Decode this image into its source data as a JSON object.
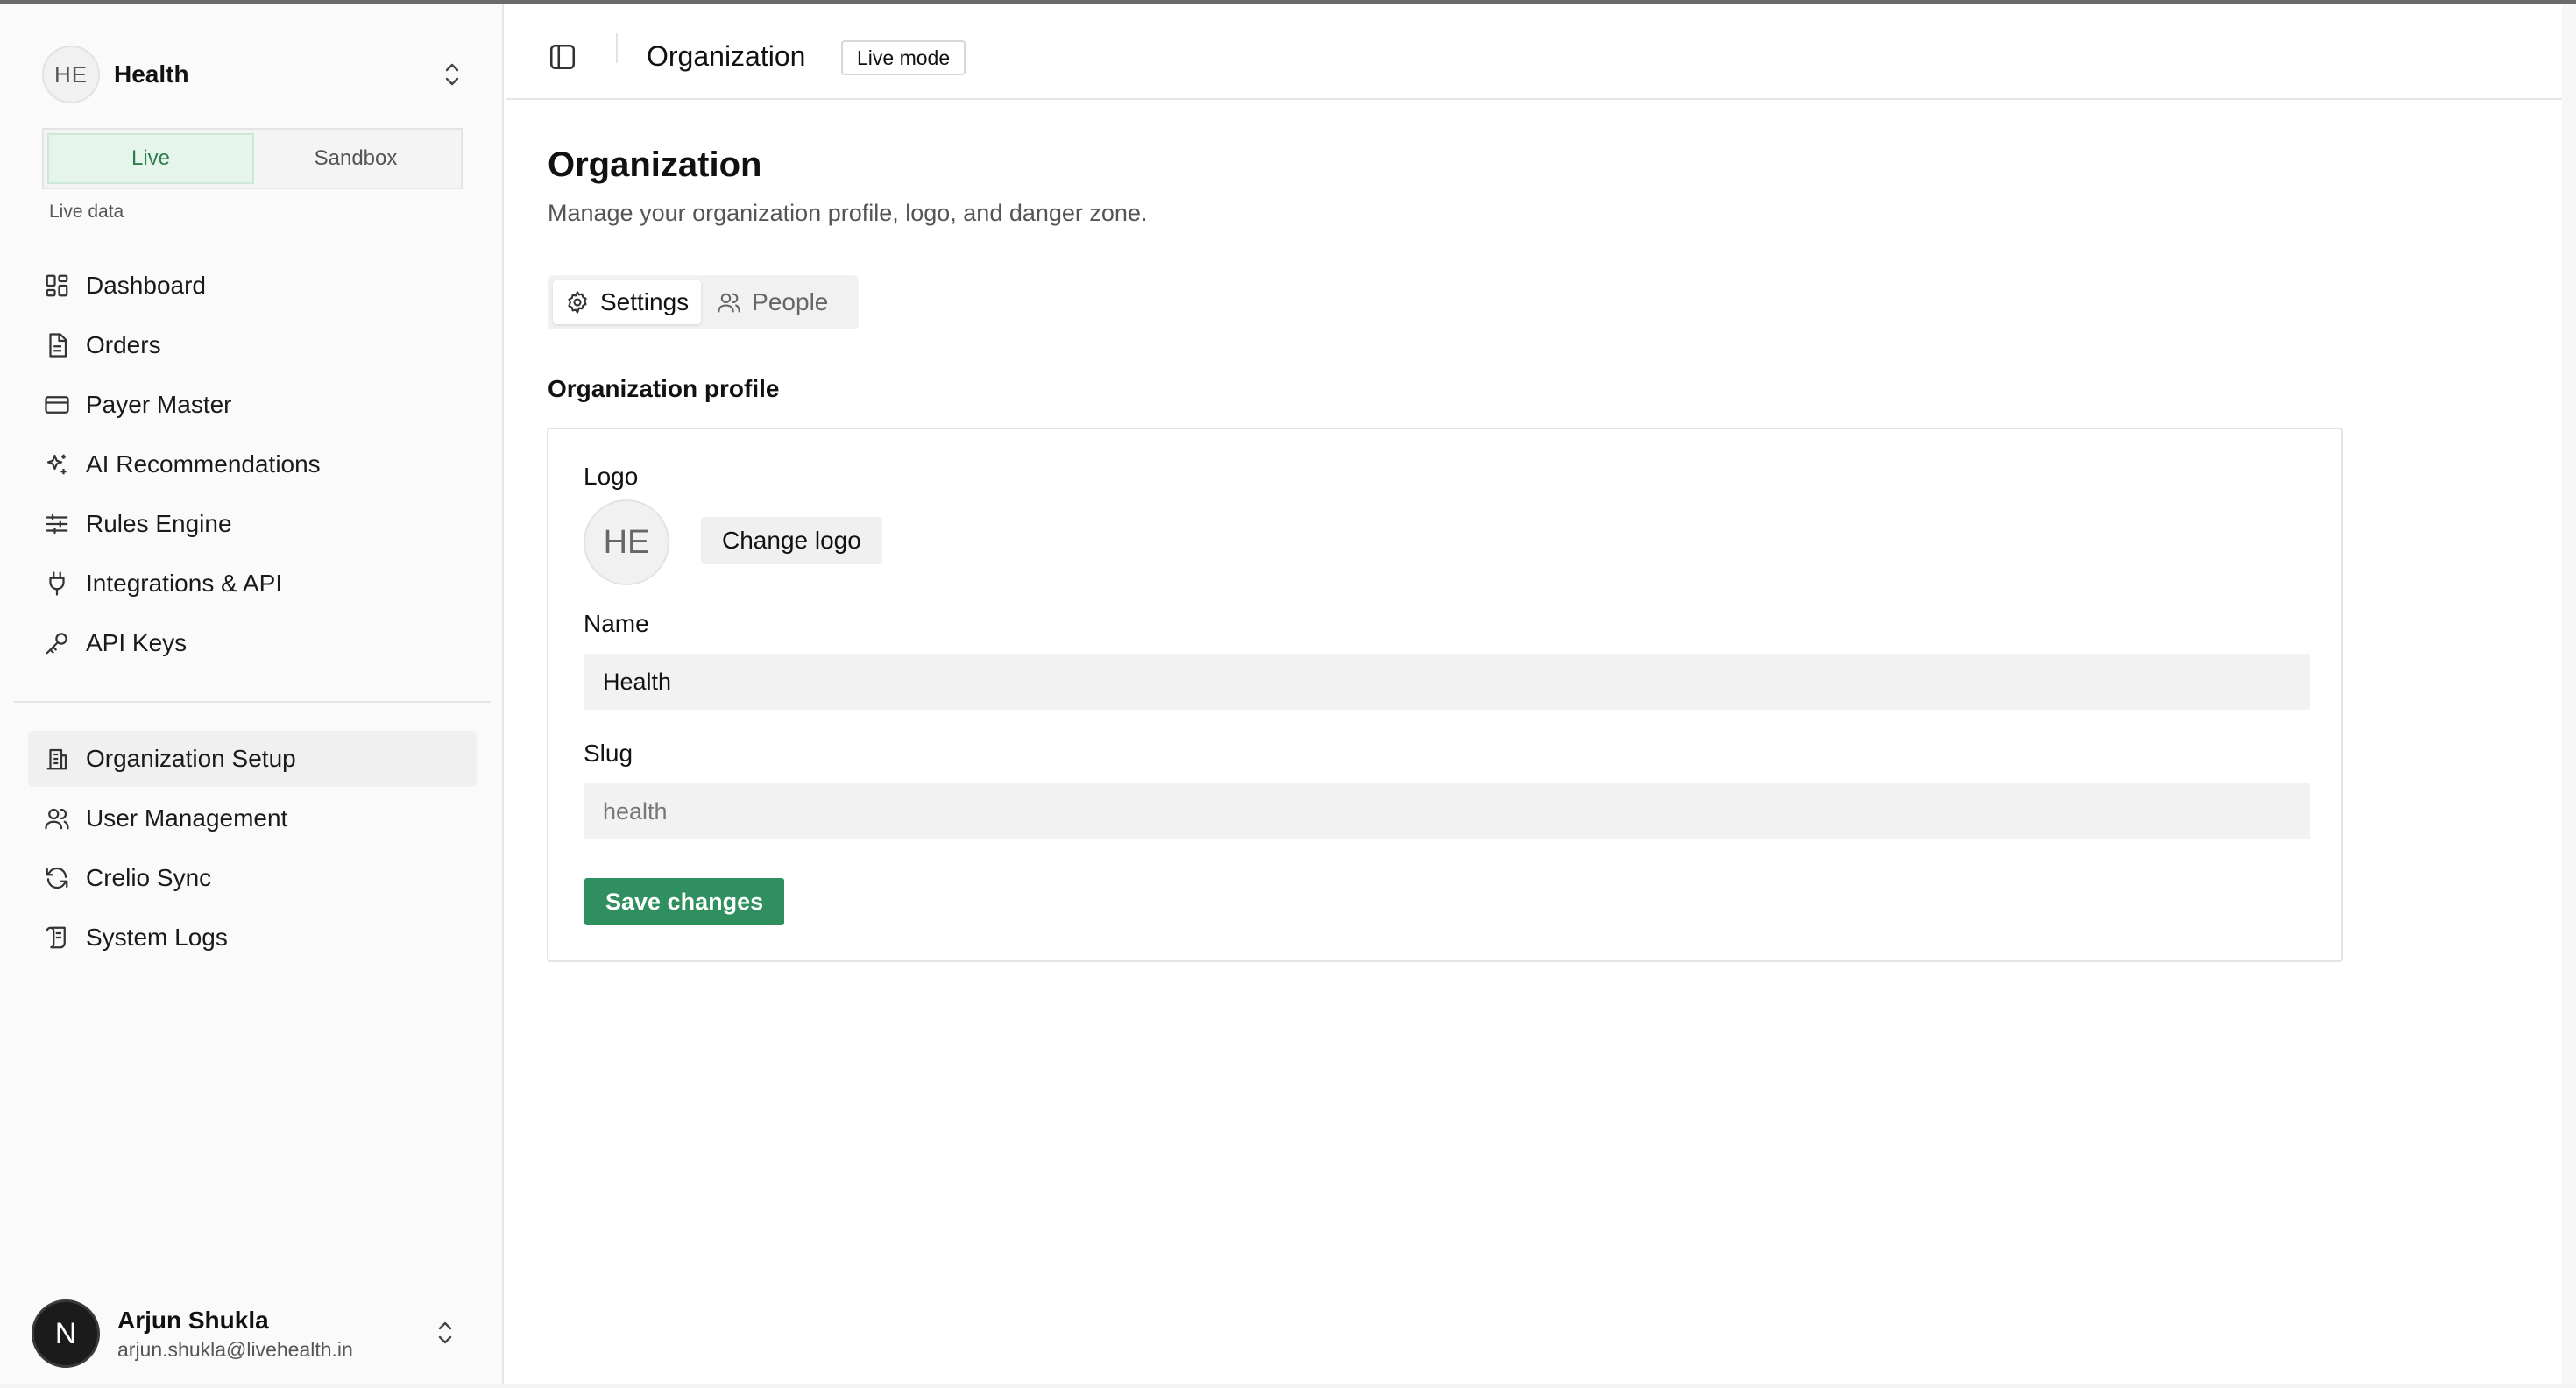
{
  "sidebar": {
    "org": {
      "initials": "HE",
      "name": "Health"
    },
    "mode_toggle": {
      "live_label": "Live",
      "sandbox_label": "Sandbox",
      "active": "Live"
    },
    "mode_caption": "Live data",
    "nav_primary": [
      {
        "label": "Dashboard",
        "icon": "dashboard-icon"
      },
      {
        "label": "Orders",
        "icon": "document-icon"
      },
      {
        "label": "Payer Master",
        "icon": "credit-card-icon"
      },
      {
        "label": "AI Recommendations",
        "icon": "sparkles-icon"
      },
      {
        "label": "Rules Engine",
        "icon": "sliders-icon"
      },
      {
        "label": "Integrations & API",
        "icon": "plug-icon"
      },
      {
        "label": "API Keys",
        "icon": "key-icon"
      }
    ],
    "nav_secondary": [
      {
        "label": "Organization Setup",
        "icon": "building-icon",
        "active": true
      },
      {
        "label": "User Management",
        "icon": "users-icon"
      },
      {
        "label": "Crelio Sync",
        "icon": "refresh-icon"
      },
      {
        "label": "System Logs",
        "icon": "scroll-icon"
      }
    ],
    "user": {
      "initial": "N",
      "name": "Arjun Shukla",
      "email": "arjun.shukla@livehealth.in"
    }
  },
  "header": {
    "title": "Organization",
    "badge": "Live mode"
  },
  "main": {
    "title": "Organization",
    "subtitle": "Manage your organization profile, logo, and danger zone.",
    "tabs": [
      {
        "label": "Settings",
        "icon": "gear-icon",
        "active": true
      },
      {
        "label": "People",
        "icon": "users-icon",
        "active": false
      }
    ],
    "section_title": "Organization profile",
    "form": {
      "logo_label": "Logo",
      "logo_initials": "HE",
      "change_logo_label": "Change logo",
      "name_label": "Name",
      "name_value": "Health",
      "slug_label": "Slug",
      "slug_value": "health",
      "save_label": "Save changes"
    }
  },
  "colors": {
    "accent_green": "#2f8f5f",
    "live_bg": "#e6f5ec",
    "live_text": "#2e7d4f"
  }
}
